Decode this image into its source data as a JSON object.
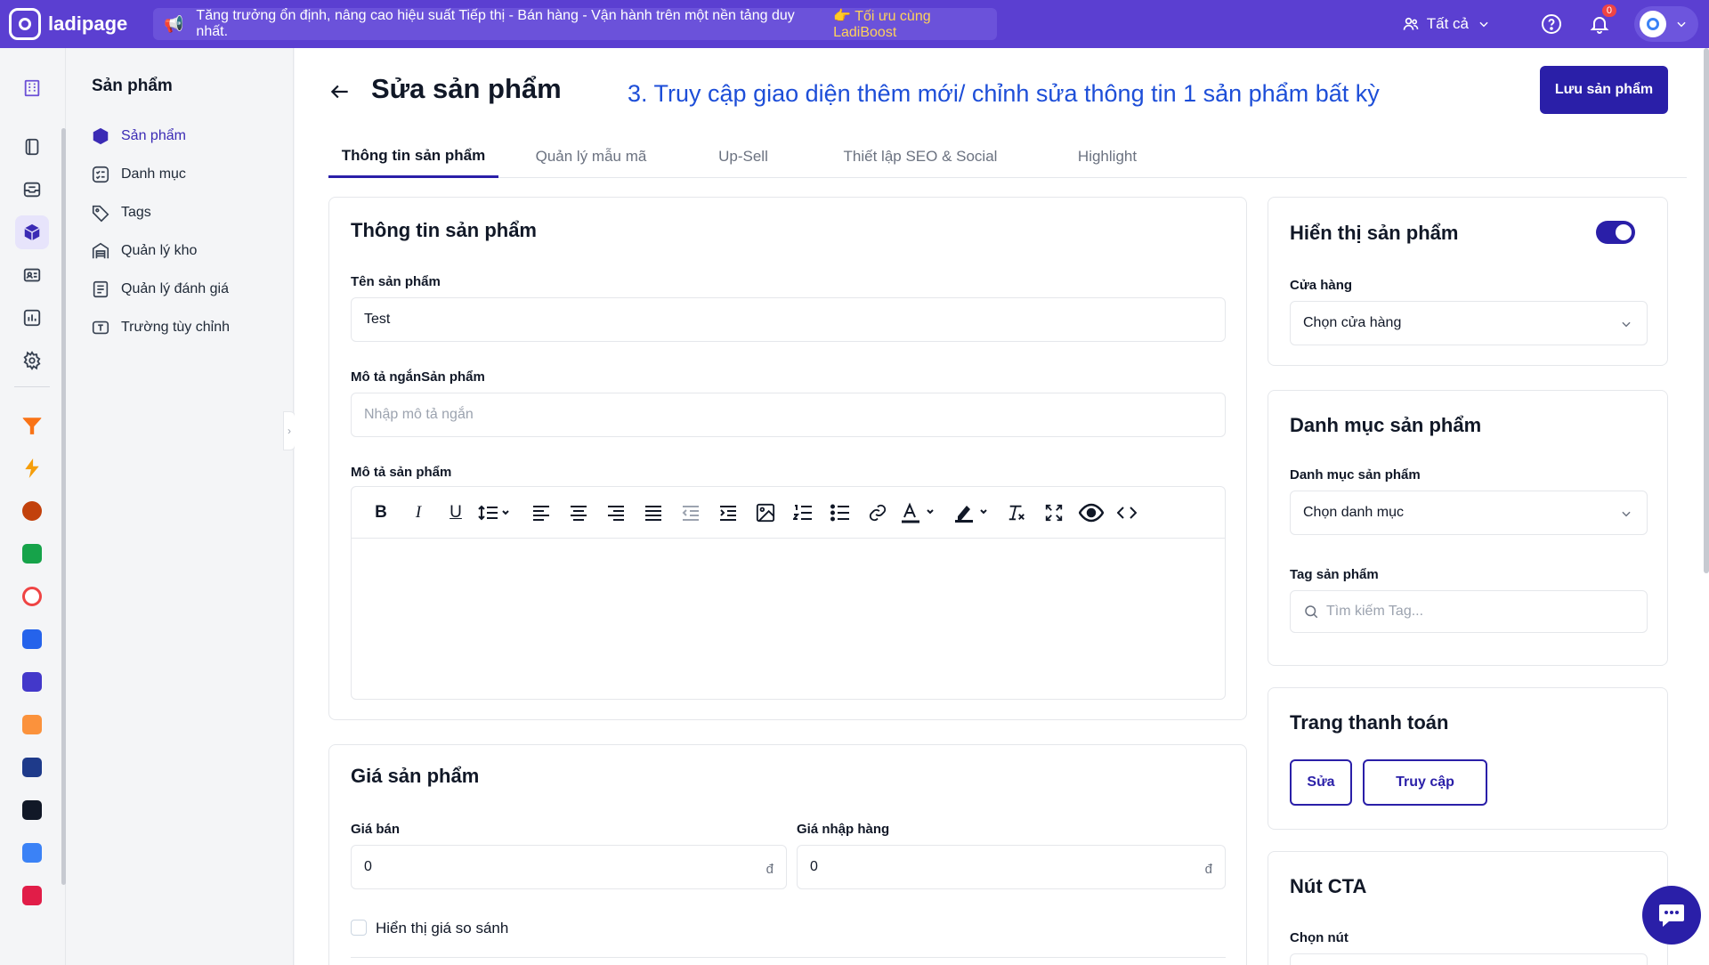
{
  "topbar": {
    "brand": "ladipage",
    "announcement": "Tăng trưởng ổn định, nâng cao hiệu suất Tiếp thị - Bán hàng - Vận hành trên một nền tảng duy nhất.",
    "announcement_cta": "👉 Tối ưu cùng LadiBoost",
    "workspace": "Tất cả",
    "notification_count": "0"
  },
  "sidebar": {
    "title": "Sản phẩm",
    "items": [
      {
        "label": "Sản phẩm",
        "icon": "box-icon",
        "active": true
      },
      {
        "label": "Danh mục",
        "icon": "category-icon",
        "active": false
      },
      {
        "label": "Tags",
        "icon": "tag-icon",
        "active": false
      },
      {
        "label": "Quản lý kho",
        "icon": "warehouse-icon",
        "active": false
      },
      {
        "label": "Quản lý đánh giá",
        "icon": "review-icon",
        "active": false
      },
      {
        "label": "Trường tùy chỉnh",
        "icon": "custom-field-icon",
        "active": false
      }
    ]
  },
  "header": {
    "title": "Sửa sản phẩm",
    "note": "3. Truy cập giao diện thêm mới/ chỉnh sửa thông tin 1 sản phẩm bất kỳ",
    "save_label": "Lưu sản phẩm"
  },
  "tabs": [
    {
      "label": "Thông tin sản phẩm",
      "active": true
    },
    {
      "label": "Quản lý mẫu mã",
      "active": false
    },
    {
      "label": "Up-Sell",
      "active": false
    },
    {
      "label": "Thiết lập SEO & Social",
      "active": false
    },
    {
      "label": "Highlight",
      "active": false
    }
  ],
  "product_info": {
    "title": "Thông tin sản phẩm",
    "name_label": "Tên sản phẩm",
    "name_value": "Test",
    "short_desc_label": "Mô tả ngắnSản phẩm",
    "short_desc_placeholder": "Nhập mô tả ngắn",
    "desc_label": "Mô tả sản phẩm",
    "toolbar": [
      "bold-icon",
      "italic-icon",
      "underline-icon",
      "line-height-icon",
      "align-left-icon",
      "align-center-icon",
      "align-right-icon",
      "align-justify-icon",
      "outdent-icon",
      "indent-icon",
      "image-icon",
      "ordered-list-icon",
      "bullet-list-icon",
      "link-icon",
      "text-color-icon",
      "highlight-icon",
      "clear-format-icon",
      "fullscreen-icon",
      "preview-icon",
      "code-icon"
    ]
  },
  "price": {
    "title": "Giá sản phẩm",
    "sale_label": "Giá bán",
    "sale_value": "0",
    "cost_label": "Giá nhập hàng",
    "cost_value": "0",
    "currency": "đ",
    "compare_label": "Hiển thị giá so sánh"
  },
  "display": {
    "title": "Hiển thị sản phẩm",
    "enabled": true,
    "store_label": "Cửa hàng",
    "store_placeholder": "Chọn cửa hàng"
  },
  "category": {
    "title": "Danh mục sản phẩm",
    "category_label": "Danh mục sản phẩm",
    "category_placeholder": "Chọn danh mục",
    "tag_label": "Tag sản phẩm",
    "tag_placeholder": "Tìm kiếm Tag..."
  },
  "checkout": {
    "title": "Trang thanh toán",
    "edit_label": "Sửa",
    "visit_label": "Truy cập"
  },
  "cta": {
    "title": "Nút CTA",
    "select_label": "Chọn nút"
  },
  "colors": {
    "brand": "#5b3fd1",
    "primary": "#2a1fa8",
    "note": "#1d4ed8"
  }
}
